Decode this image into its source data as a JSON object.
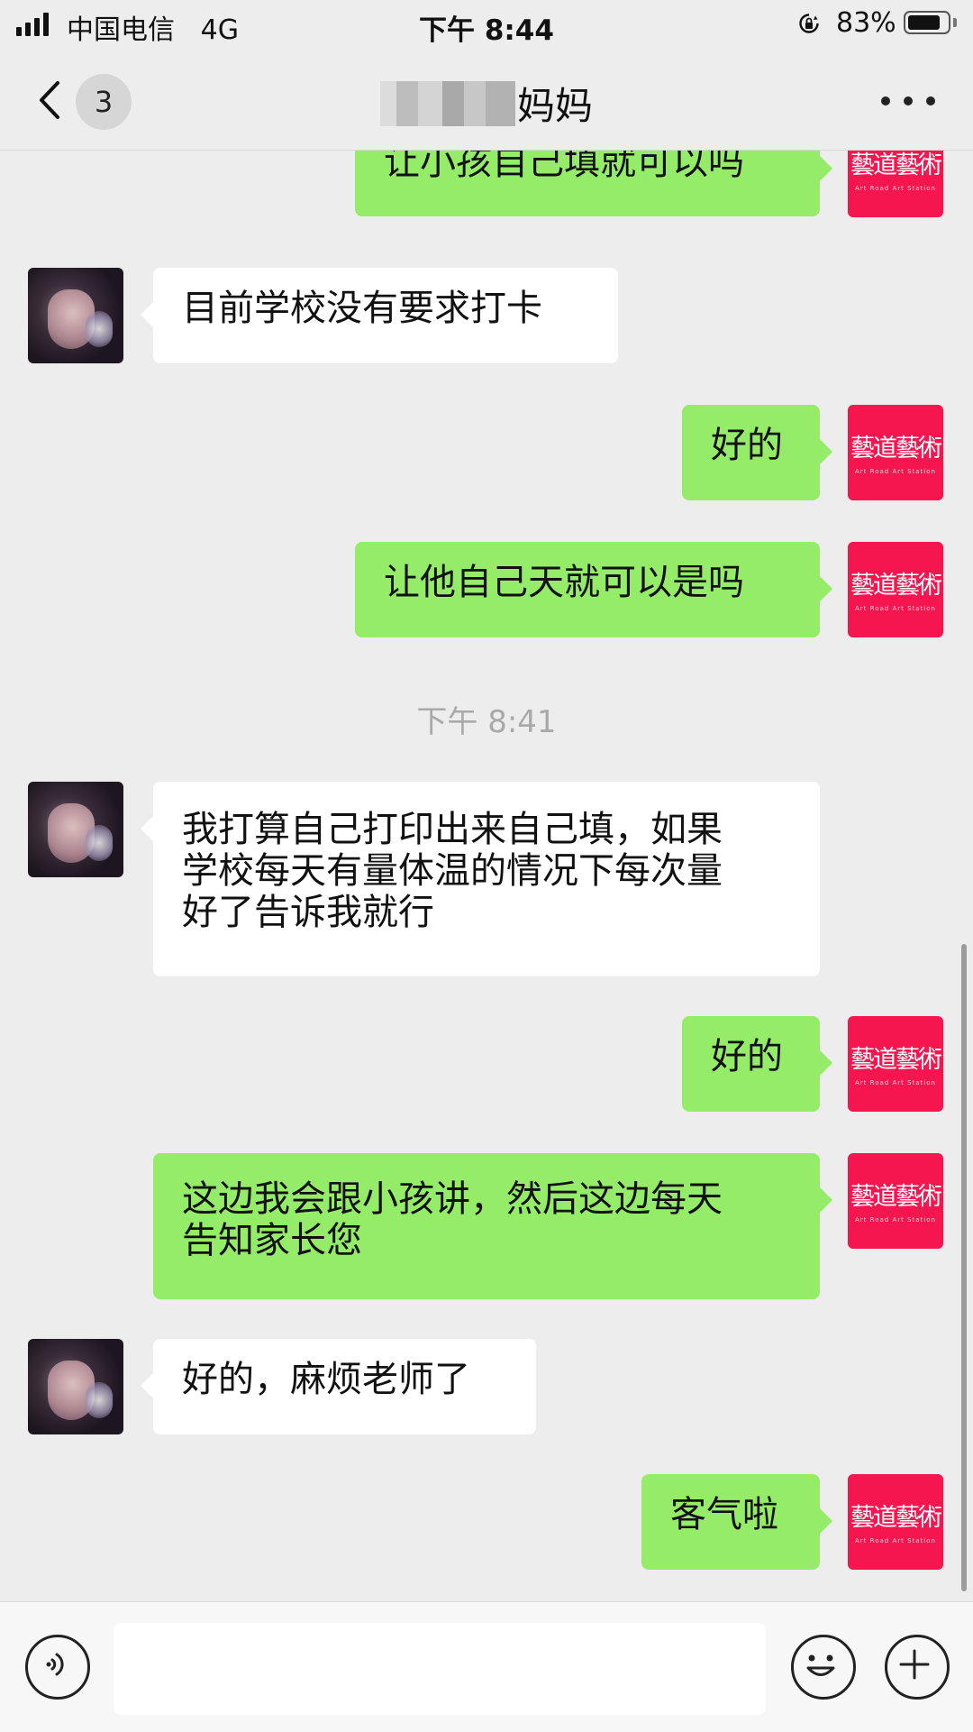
{
  "status_bar": {
    "carrier": "中国电信",
    "network": "4G",
    "time": "下午 8:44",
    "battery_percent": "83%",
    "battery_level": 0.83,
    "signal_bars": 4
  },
  "nav": {
    "badge_count": "3",
    "title_visible": "妈妈",
    "back_icon": "chevron-left-icon",
    "more_icon": "ellipsis-icon"
  },
  "self_avatar": {
    "logo_text": "藝道藝術",
    "sub_text": "Art Road Art Station"
  },
  "messages": [
    {
      "from": "self",
      "text": "让小孩自己填就可以吗"
    },
    {
      "from": "contact",
      "text": "目前学校没有要求打卡"
    },
    {
      "from": "self",
      "text": "好的"
    },
    {
      "from": "self",
      "text": "让他自己天就可以是吗"
    },
    {
      "type": "timestamp",
      "text": "下午 8:41"
    },
    {
      "from": "contact",
      "lines": [
        "我打算自己打印出来自己填，如果",
        "学校每天有量体温的情况下每次量",
        "好了告诉我就行"
      ]
    },
    {
      "from": "self",
      "text": "好的"
    },
    {
      "from": "self",
      "lines": [
        "这边我会跟小孩讲，然后这边每天",
        "告知家长您"
      ]
    },
    {
      "from": "contact",
      "text": "好的，麻烦老师了"
    },
    {
      "from": "self",
      "text": "客气啦"
    }
  ],
  "input_bar": {
    "voice_icon": "voice-icon",
    "emoji_icon": "emoji-icon",
    "plus_icon": "plus-icon",
    "text_value": ""
  },
  "colors": {
    "background": "#ededed",
    "outgoing_bubble": "#95ec69",
    "incoming_bubble": "#ffffff",
    "logo_red": "#f5154f"
  }
}
